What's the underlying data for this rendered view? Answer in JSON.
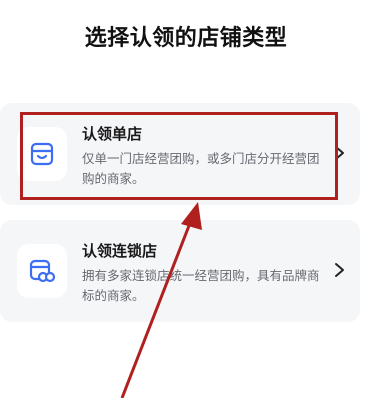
{
  "page": {
    "title": "选择认领的店铺类型"
  },
  "options": [
    {
      "title": "认领单店",
      "description": "仅单一门店经营团购，或多门店分开经营团购的商家。",
      "icon": "store-icon"
    },
    {
      "title": "认领连锁店",
      "description": "拥有多家连锁店统一经营团购，具有品牌商标的商家。",
      "icon": "chain-store-icon"
    }
  ],
  "colors": {
    "accent_icon": "#3d6df0",
    "annotation_red": "#b0201e",
    "card_bg": "#f5f6f8"
  }
}
